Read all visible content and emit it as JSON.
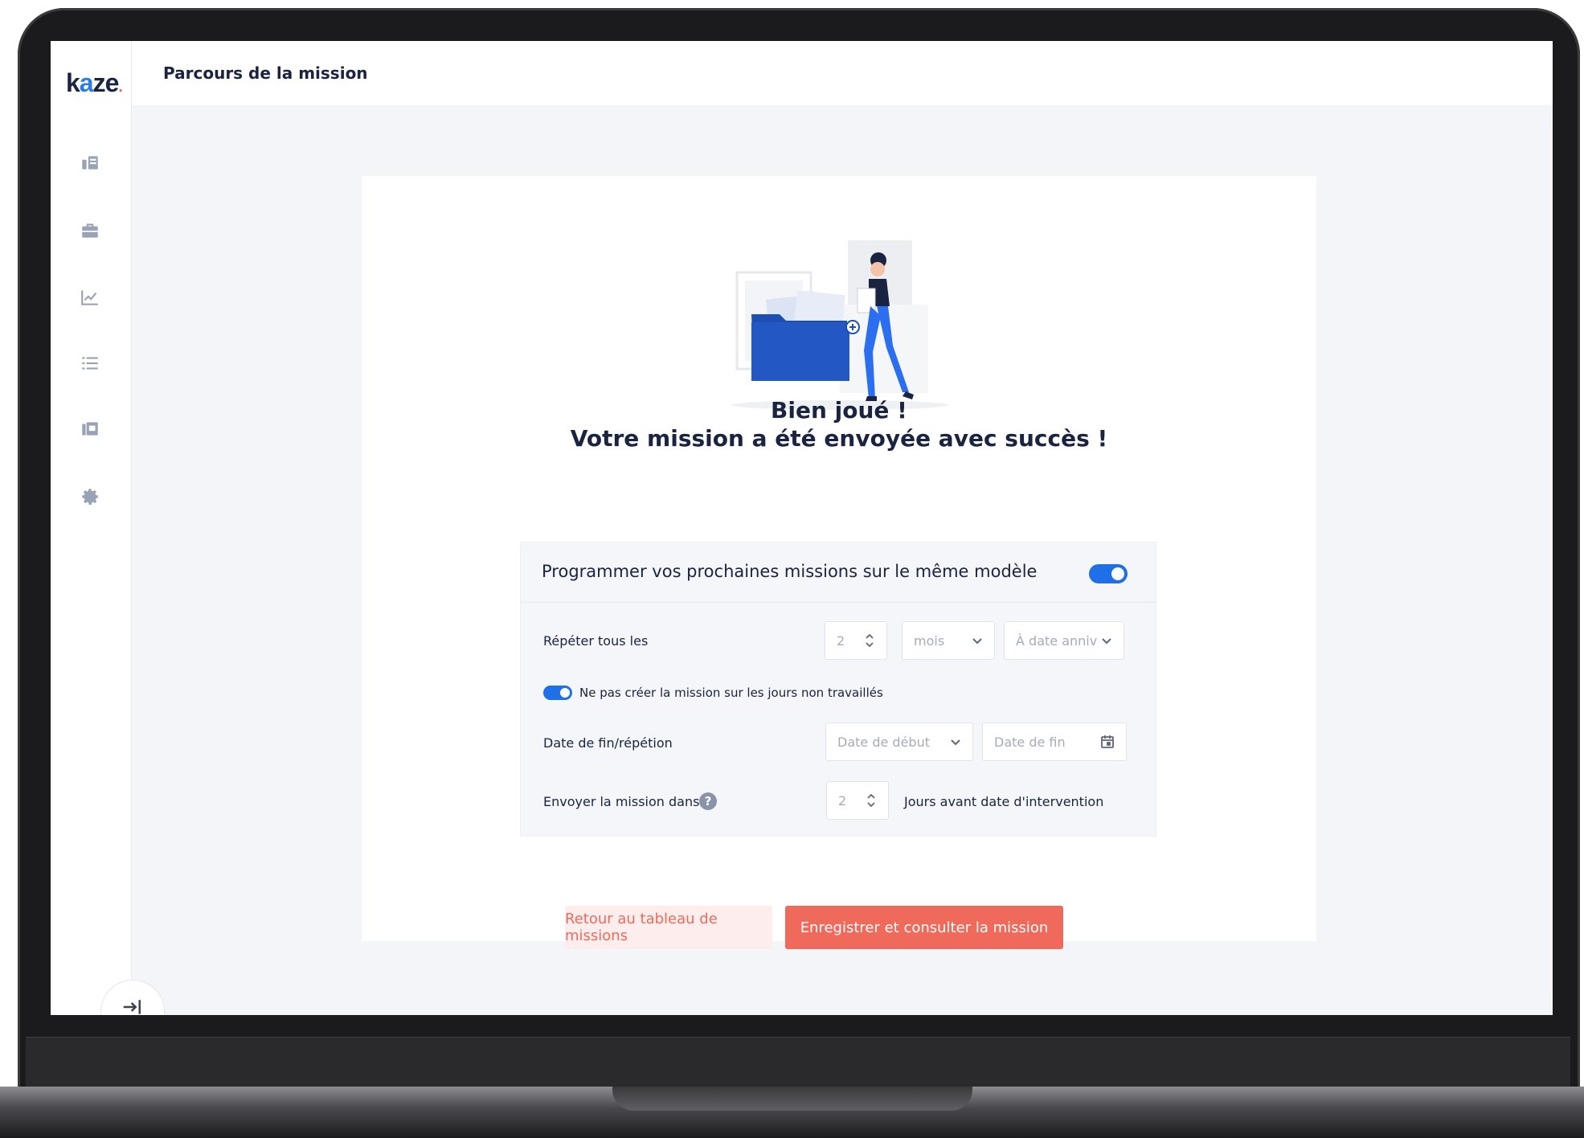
{
  "app": {
    "logo": {
      "k": "k",
      "a": "a",
      "z": "z",
      "e": "e"
    },
    "page_title": "Parcours de la mission"
  },
  "sidebar": {
    "items": [
      {
        "icon": "dashboard-icon"
      },
      {
        "icon": "briefcase-icon"
      },
      {
        "icon": "chart-icon"
      },
      {
        "icon": "list-icon"
      },
      {
        "icon": "gallery-icon"
      },
      {
        "icon": "gear-icon"
      }
    ],
    "exit_icon": "logout-icon"
  },
  "success": {
    "line1": "Bien joué !",
    "line2": "Votre mission a été envoyée avec succès !"
  },
  "schedule": {
    "header_label": "Programmer vos prochaines missions sur le même modèle",
    "header_toggle_on": true,
    "repeat_label": "Répéter tous les",
    "repeat_value": "2",
    "repeat_unit": "mois",
    "repeat_mode": "À date anniv",
    "skip_nonworking_on": true,
    "skip_nonworking_label": "Ne pas créer la mission sur les jours non travaillés",
    "end_label": "Date de fin/répétion",
    "start_placeholder": "Date de début",
    "end_placeholder": "Date de fin",
    "send_label": "Envoyer la mission dans",
    "send_value": "2",
    "send_suffix": "Jours avant date d'intervention",
    "help_glyph": "?"
  },
  "actions": {
    "back_label": "Retour au tableau de missions",
    "save_label": "Enregistrer et consulter la mission"
  },
  "colors": {
    "brand_blue": "#1f6fe8",
    "accent_coral": "#f06a5c",
    "navy_text": "#1a2340"
  }
}
